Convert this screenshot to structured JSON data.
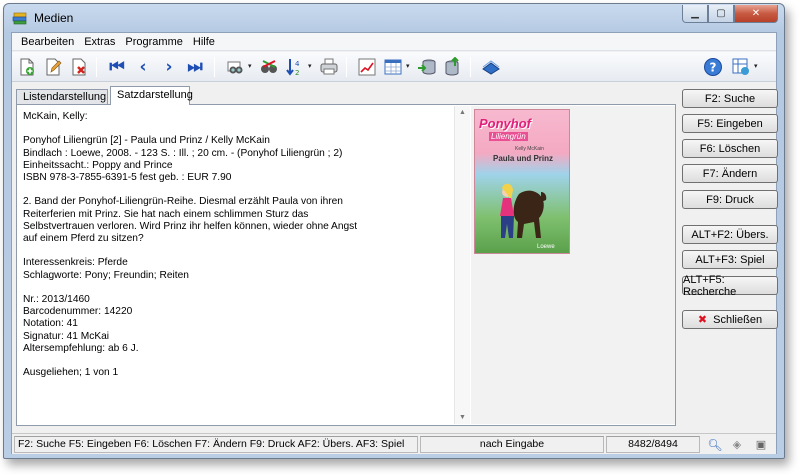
{
  "window": {
    "title": "Medien"
  },
  "menu": [
    "Bearbeiten",
    "Extras",
    "Programme",
    "Hilfe"
  ],
  "toolbar_icons": [
    "new-record-icon",
    "edit-record-icon",
    "delete-record-icon",
    "first-record-icon",
    "previous-record-icon",
    "next-record-icon",
    "last-record-icon",
    "search-binoculars-icon",
    "filter-icon",
    "sort-icon",
    "print-icon",
    "chart-icon",
    "table-icon",
    "import-icon",
    "export-icon",
    "tools-icon",
    "help-icon",
    "layout-icon"
  ],
  "tabs": [
    {
      "label": "Listendarstellung",
      "active": false
    },
    {
      "label": "Satzdarstellung",
      "active": true
    }
  ],
  "record": {
    "lines": [
      "McKain, Kelly:",
      "",
      "Ponyhof Liliengrün [2] - Paula und Prinz / Kelly McKain",
      "Bindlach : Loewe, 2008. - 123 S. : Ill. ; 20 cm. - (Ponyhof Liliengrün ; 2)",
      "Einheitssacht.: Poppy and Prince",
      "ISBN 978-3-7855-6391-5 fest geb. : EUR 7.90",
      "",
      "2. Band der Ponyhof-Liliengrün-Reihe. Diesmal erzählt Paula von ihren",
      "Reiterferien mit Prinz. Sie hat nach einem schlimmen Sturz das",
      "Selbstvertrauen verloren. Wird Prinz ihr helfen können, wieder ohne Angst",
      "auf einem Pferd zu sitzen?",
      "",
      "Interessenkreis: Pferde",
      "Schlagworte: Pony; Freundin; Reiten",
      "",
      "Nr.: 2013/1460",
      "Barcodenummer: 14220",
      "Notation: 41",
      "Signatur: 41 McKai",
      "Altersempfehlung: ab 6 J.",
      "",
      "Ausgeliehen; 1 von 1"
    ]
  },
  "cover": {
    "title": "Ponyhof",
    "subtitle": "Liliengrün",
    "author": "Kelly McKain",
    "book_title": "Paula und Prinz",
    "publisher": "Loewe"
  },
  "buttons": {
    "suche": "F2: Suche",
    "eingeben": "F5: Eingeben",
    "loeschen": "F6: Löschen",
    "aendern": "F7: Ändern",
    "druck": "F9: Druck",
    "uebers": "ALT+F2: Übers.",
    "spiel": "ALT+F3: Spiel",
    "recherche": "ALT+F5: Recherche",
    "schliessen": "Schließen"
  },
  "status": {
    "shortcuts": "F2: Suche   F5: Eingeben   F6: Löschen   F7: Ändern   F9: Druck   AF2: Übers.   AF3: Spiel",
    "mode": "nach Eingabe",
    "position": "8482/8494"
  }
}
